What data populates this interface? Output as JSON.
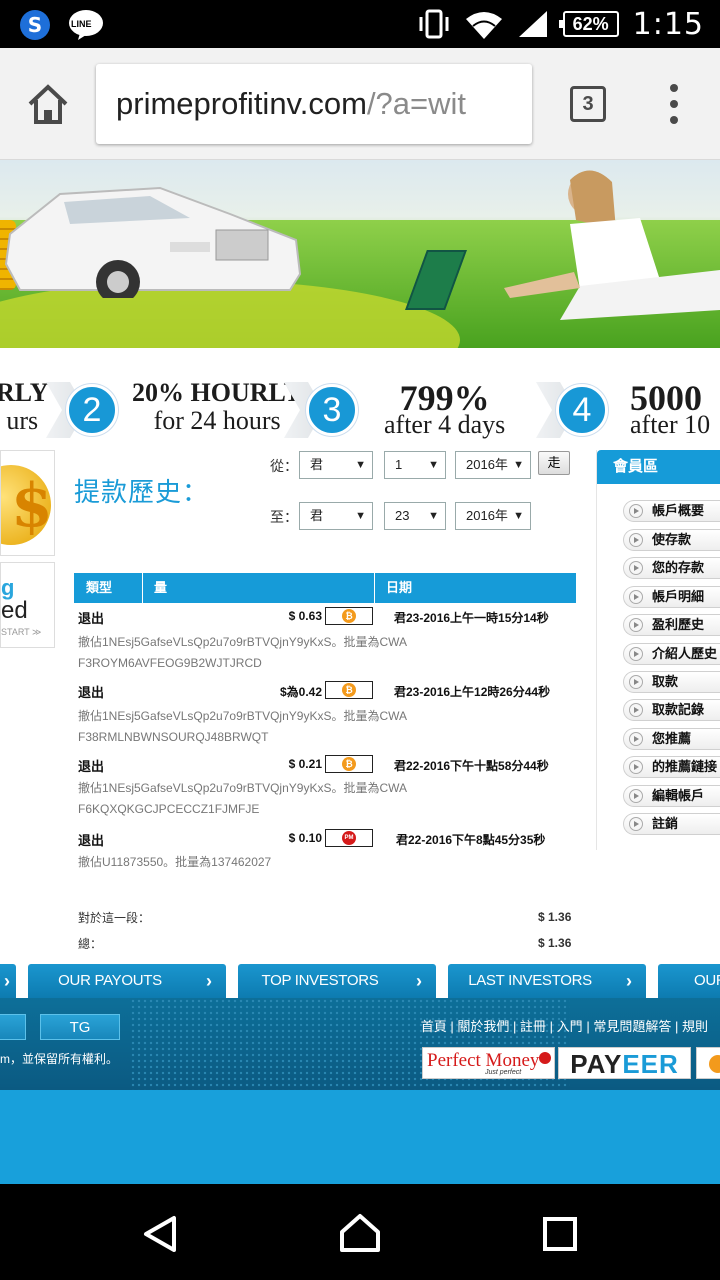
{
  "status_bar": {
    "time": "1:15",
    "battery": "62%",
    "apps": [
      "s-app-icon",
      "line-icon"
    ],
    "line_label": "LINE"
  },
  "browser": {
    "url_host": "primeprofitinv.com",
    "url_path": "/?a=wit",
    "tab_count": "3"
  },
  "plans": [
    {
      "num": "",
      "big": "RLY",
      "small": "urs"
    },
    {
      "num": "2",
      "big": "20% HOURLY",
      "small": "for 24 hours"
    },
    {
      "num": "3",
      "big": "799%",
      "small": "after 4 days"
    },
    {
      "num": "4",
      "big": "5000",
      "small": "after 10"
    }
  ],
  "side_promo": {
    "title_fragment": "g",
    "sub_fragment": "ed",
    "start": "START ≫"
  },
  "page": {
    "title": "提款歷史："
  },
  "filters": {
    "from_label": "從：",
    "to_label": "至：",
    "from": {
      "month": "君",
      "day": "1",
      "year": "2016年"
    },
    "to": {
      "month": "君",
      "day": "23",
      "year": "2016年"
    },
    "go_label": "走"
  },
  "table": {
    "headers": {
      "type": "類型",
      "amount": "量",
      "date": "日期"
    },
    "rows": [
      {
        "type": "退出",
        "amount": "$ 0.63",
        "method": "bitcoin",
        "date": "君23-2016上午一時15分14秒",
        "note": "撤佔1NEsj5GafseVLsQp2u7o9rBTVQjnY9yKxS。批量為CWAF3ROYM6AVFEOG9B2WJTJRCD"
      },
      {
        "type": "退出",
        "amount": "$為0.42",
        "method": "bitcoin",
        "date": "君23-2016上午12時26分44秒",
        "note": "撤佔1NEsj5GafseVLsQp2u7o9rBTVQjnY9yKxS。批量為CWAF38RMLNBWNSOURQJ48BRWQT"
      },
      {
        "type": "退出",
        "amount": "$ 0.21",
        "method": "bitcoin",
        "date": "君22-2016下午十點58分44秒",
        "note": "撤佔1NEsj5GafseVLsQp2u7o9rBTVQjnY9yKxS。批量為CWAF6KQXQKGCJPCECCZ1FJMFJE"
      },
      {
        "type": "退出",
        "amount": "$ 0.10",
        "method": "perfect-money",
        "date": "君22-2016下午8點45分35秒",
        "note": "撤佔U11873550。批量為137462027"
      }
    ],
    "period_label": "對於這一段：",
    "period_total": "$ 1.36",
    "total_label": "總：",
    "total": "$ 1.36"
  },
  "member": {
    "title": "會員區",
    "items": [
      "帳戶概要",
      "使存款",
      "您的存款",
      "帳戶明細",
      "盈利歷史",
      "介紹人歷史",
      "取款",
      "取款記錄",
      "您推薦",
      "的推薦鏈接",
      "編輯帳戶",
      "註銷"
    ]
  },
  "footer_nav": [
    {
      "label": "OUR PAYOUTS"
    },
    {
      "label": "TOP INVESTORS"
    },
    {
      "label": "LAST INVESTORS"
    },
    {
      "label": "OUR"
    }
  ],
  "footer": {
    "tg_label": "TG",
    "links": [
      "首頁",
      "關於我們",
      "註冊",
      "入門",
      "常見問題解答",
      "規則"
    ],
    "copyright": "m，並保留所有權利。",
    "pm_logo": "Perfect Money",
    "pm_tagline": "Just perfect",
    "payeer_pay": "PAY",
    "payeer_eer": "EER"
  },
  "colors": {
    "accent": "#169bd8",
    "footer": "#0b5a82",
    "bitcoin": "#f39a1c",
    "perfect_money": "#d51a1a"
  }
}
